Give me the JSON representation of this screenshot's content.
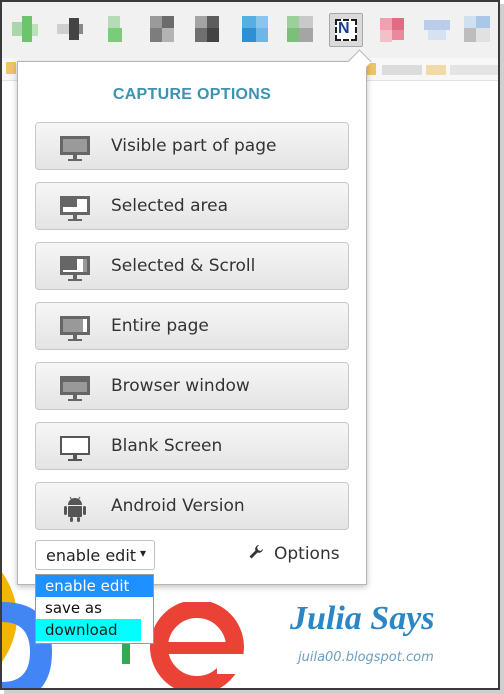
{
  "popup": {
    "title": "CAPTURE OPTIONS",
    "options": [
      {
        "label": "Visible part of page",
        "icon": "monitor-icon"
      },
      {
        "label": "Selected area",
        "icon": "monitor-selection-icon"
      },
      {
        "label": "Selected & Scroll",
        "icon": "monitor-scroll-icon"
      },
      {
        "label": "Entire page",
        "icon": "monitor-entire-icon"
      },
      {
        "label": "Browser window",
        "icon": "monitor-window-icon"
      },
      {
        "label": "Blank Screen",
        "icon": "monitor-blank-icon"
      },
      {
        "label": "Android Version",
        "icon": "android-icon"
      }
    ],
    "mode_select": {
      "value": "enable edit",
      "caret": "▾"
    },
    "options_link": "Options"
  },
  "dropdown": {
    "items": [
      "enable edit",
      "save as",
      "download"
    ],
    "highlighted": "enable edit",
    "hover": "download"
  },
  "toolbar": {
    "extension_letter": "N"
  },
  "background": {
    "brand": "Julia Says",
    "blog": "juila00.blogspot.com"
  },
  "colors": {
    "accent": "#3a93b2",
    "dropdown_highlight": "#1e90ff",
    "dropdown_hover": "#00ffff"
  }
}
